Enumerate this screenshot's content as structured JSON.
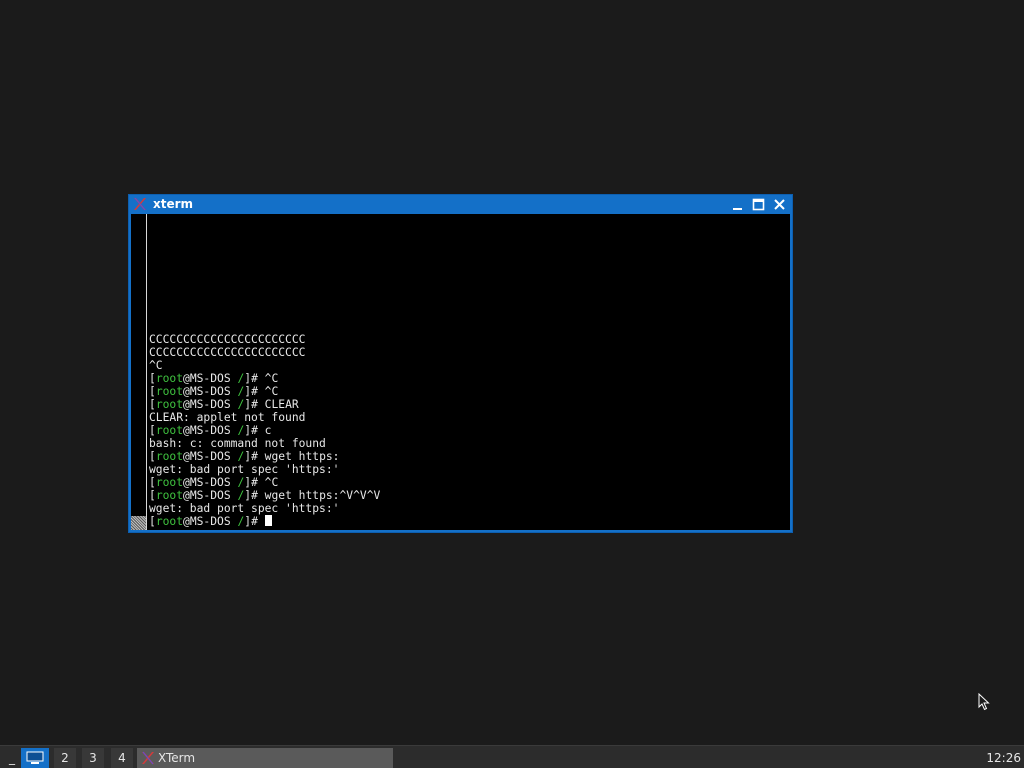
{
  "window": {
    "title": "xterm",
    "icon": "x-logo-icon",
    "controls": [
      "minimize-icon",
      "maximize-icon",
      "close-icon"
    ]
  },
  "terminal": {
    "lines": [
      [
        {
          "t": "CCCCCCCCCCCCCCCCCCCCCCC"
        }
      ],
      [
        {
          "t": "CCCCCCCCCCCCCCCCCCCCCCC"
        }
      ],
      [
        {
          "t": "^C"
        }
      ],
      [
        {
          "t": "["
        },
        {
          "t": "root",
          "g": true
        },
        {
          "t": "@MS-DOS "
        },
        {
          "t": "/",
          "g": true
        },
        {
          "t": "]# ^C"
        }
      ],
      [
        {
          "t": "["
        },
        {
          "t": "root",
          "g": true
        },
        {
          "t": "@MS-DOS "
        },
        {
          "t": "/",
          "g": true
        },
        {
          "t": "]# ^C"
        }
      ],
      [
        {
          "t": "["
        },
        {
          "t": "root",
          "g": true
        },
        {
          "t": "@MS-DOS "
        },
        {
          "t": "/",
          "g": true
        },
        {
          "t": "]# CLEAR"
        }
      ],
      [
        {
          "t": "CLEAR: applet not found"
        }
      ],
      [
        {
          "t": "["
        },
        {
          "t": "root",
          "g": true
        },
        {
          "t": "@MS-DOS "
        },
        {
          "t": "/",
          "g": true
        },
        {
          "t": "]# c"
        }
      ],
      [
        {
          "t": "bash: c: command not found"
        }
      ],
      [
        {
          "t": "["
        },
        {
          "t": "root",
          "g": true
        },
        {
          "t": "@MS-DOS "
        },
        {
          "t": "/",
          "g": true
        },
        {
          "t": "]# wget https:"
        }
      ],
      [
        {
          "t": "wget: bad port spec 'https:'"
        }
      ],
      [
        {
          "t": "["
        },
        {
          "t": "root",
          "g": true
        },
        {
          "t": "@MS-DOS "
        },
        {
          "t": "/",
          "g": true
        },
        {
          "t": "]# ^C"
        }
      ],
      [
        {
          "t": "["
        },
        {
          "t": "root",
          "g": true
        },
        {
          "t": "@MS-DOS "
        },
        {
          "t": "/",
          "g": true
        },
        {
          "t": "]# wget https:^V^V^V"
        }
      ],
      [
        {
          "t": "wget: bad port spec 'https:'"
        }
      ],
      [
        {
          "t": "["
        },
        {
          "t": "root",
          "g": true
        },
        {
          "t": "@MS-DOS "
        },
        {
          "t": "/",
          "g": true
        },
        {
          "t": "]# "
        }
      ]
    ]
  },
  "taskbar": {
    "minimize_label": "_",
    "desktops": [
      "2",
      "3",
      "4"
    ],
    "task_label": "XTerm",
    "clock": "12:26"
  },
  "colors": {
    "title_blue": "#1470c8",
    "prompt_green": "#3fc23f",
    "desktop_bg": "#1b1b1b"
  }
}
